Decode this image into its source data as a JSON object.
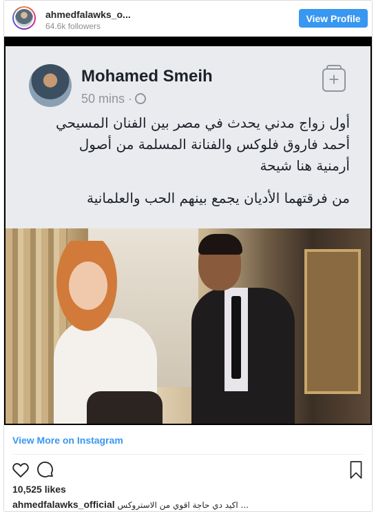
{
  "header": {
    "username": "ahmedfalawks_o...",
    "followers": "64.6k followers",
    "view_profile_label": "View Profile"
  },
  "media": {
    "fb_post": {
      "author": "Mohamed Smeih",
      "time": "50 mins ·",
      "lines": [
        "أول زواج مدني يحدث في مصر بين الفنان المسيحي",
        "أحمد فاروق فلوكس والفنانة المسلمة من أصول",
        "أرمنية هنا شيحة"
      ],
      "line2": "من فرقتهما الأديان يجمع بينهم الحب والعلمانية"
    }
  },
  "footer": {
    "view_more_label": "View More on Instagram",
    "likes": "10,525 likes",
    "caption_user": "ahmedfalawks_official",
    "caption_text": "اكيد دي حاجة اقوي من الاستروكس ..."
  },
  "colors": {
    "accent": "#3897f0",
    "text": "#262626",
    "muted": "#8e8e8e"
  }
}
